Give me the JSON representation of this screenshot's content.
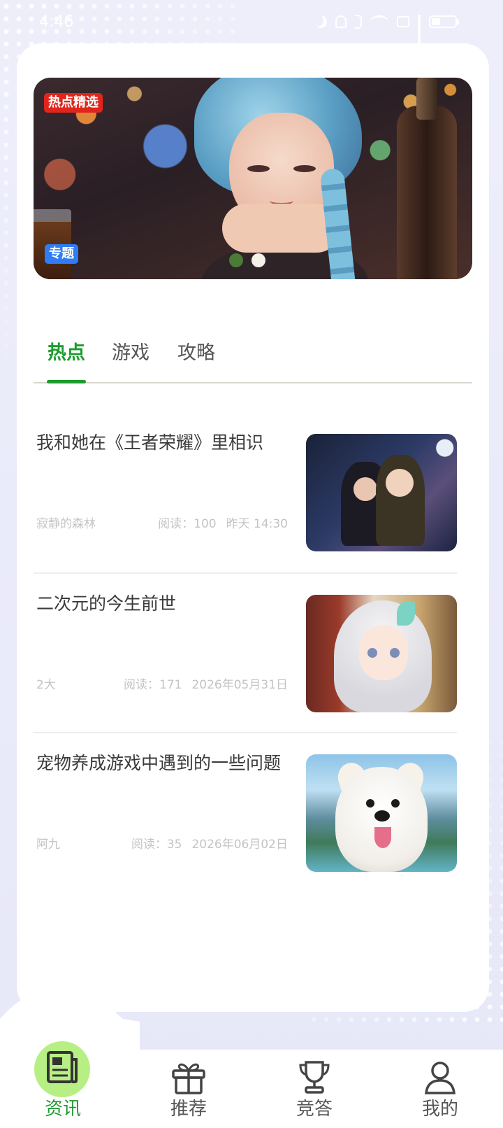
{
  "status_bar": {
    "time": "4:46"
  },
  "banner": {
    "badge_hot": "热点精选",
    "badge_topic": "专题",
    "indicator_count": 2,
    "active_index": 0
  },
  "tabs": [
    {
      "label": "热点",
      "active": true
    },
    {
      "label": "游戏",
      "active": false
    },
    {
      "label": "攻略",
      "active": false
    }
  ],
  "articles": [
    {
      "title": "我和她在《王者荣耀》里相识",
      "author": "寂静的森林",
      "reads": "阅读：100",
      "date": "昨天 14:30"
    },
    {
      "title": "二次元的今生前世",
      "author": "2大",
      "reads": "阅读：171",
      "date": "2026年05月31日"
    },
    {
      "title": "宠物养成游戏中遇到的一些问题",
      "author": "阿九",
      "reads": "阅读：35",
      "date": "2026年06月02日"
    }
  ],
  "bottom_nav": [
    {
      "label": "资讯",
      "icon": "news-icon",
      "active": true
    },
    {
      "label": "推荐",
      "icon": "gift-icon",
      "active": false
    },
    {
      "label": "竞答",
      "icon": "trophy-icon",
      "active": false
    },
    {
      "label": "我的",
      "icon": "user-icon",
      "active": false
    }
  ],
  "colors": {
    "accent": "#1e9a2f",
    "badge_red": "#e0251c",
    "badge_blue": "#2f7cf6",
    "nav_active_bg": "#b8ef84"
  }
}
